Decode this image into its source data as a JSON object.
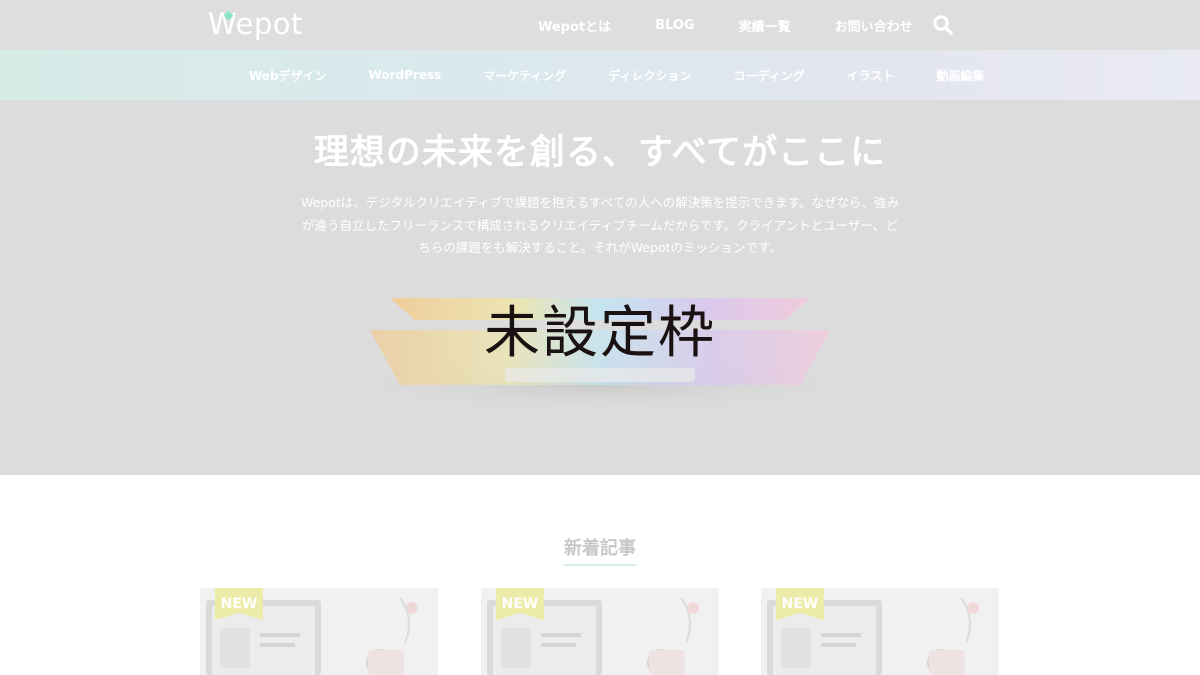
{
  "header": {
    "logo": "Wepot",
    "nav": [
      "Wepotとは",
      "BLOG",
      "実績一覧",
      "お問い合わせ"
    ],
    "search_icon": "search-icon"
  },
  "categories": [
    "Webデザイン",
    "WordPress",
    "マーケティング",
    "ディレクション",
    "コーディング",
    "イラスト",
    "動画編集"
  ],
  "hero": {
    "title": "理想の未来を創る、すべてがここに",
    "description": "Wepotは、デジタルクリエイティブで課題を抱えるすべての人への解決策を提示できます。なぜなら、強みが違う自立したフリーランスで構成されるクリエイティブチームだからです。クライアントとユーザー、どちらの課題をも解決すること。それがWepotのミッションです。",
    "placeholder": "未設定枠"
  },
  "new_posts": {
    "title": "新着記事",
    "cards": [
      {
        "badge": "NEW"
      },
      {
        "badge": "NEW"
      },
      {
        "badge": "NEW"
      }
    ]
  },
  "colors": {
    "header_bg": "#dedede",
    "hero_bg": "#dcdcdc",
    "badge_bg": "#ececa8",
    "accent": "#8fe3c8"
  }
}
